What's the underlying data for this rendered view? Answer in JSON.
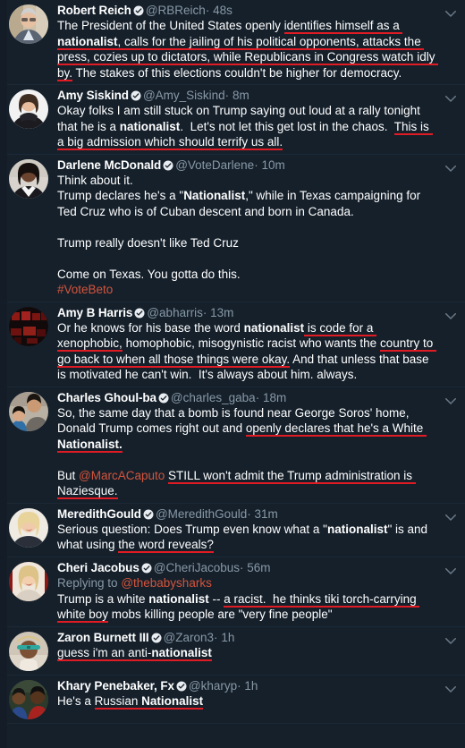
{
  "app": {
    "name": "Twitter",
    "theme": "dark",
    "background_color": "#15202b",
    "accent_color": "#1da1f2",
    "mention_color": "#d4543c",
    "annotation_underline_color": "#e01b24",
    "secondary_text_color": "#8899a6",
    "chevron_icon": "chevron-down-icon",
    "verified_icon": "verified-badge-icon",
    "time_separator": "·"
  },
  "tweets": [
    {
      "id": "tweet-robert-reich",
      "display_name": "Robert Reich",
      "verified": true,
      "handle": "@RBReich",
      "timestamp": "48s",
      "replying_to": null,
      "avatar": "photo-man-glasses-gray-jacket",
      "text_plain": "The President of the United States openly identifies himself as a nationalist, calls for the jailing of his political opponents, attacks the press, cozies up to dictators, while Republicans in Congress watch idly by. The stakes of this elections couldn't be higher for democracy.",
      "segments": [
        {
          "t": "The President of the United States openly ",
          "bold": false,
          "ul": false
        },
        {
          "t": "identifies himself as a ",
          "bold": false,
          "ul": true
        },
        {
          "t": "nationalist",
          "bold": true,
          "ul": true
        },
        {
          "t": ", calls for the jailing of his political opponents, attacks the press, cozies up to dictators, while Republicans in Congress watch idly by.",
          "bold": false,
          "ul": true
        },
        {
          "t": " The stakes of this elections couldn't be higher for democracy.",
          "bold": false,
          "ul": false
        }
      ]
    },
    {
      "id": "tweet-amy-siskind",
      "display_name": "Amy Siskind",
      "verified": true,
      "handle": "@Amy_Siskind",
      "timestamp": "8m",
      "replying_to": null,
      "avatar": "photo-woman-dark-top",
      "text_plain": "Okay folks I am still stuck on Trump saying out loud at a rally tonight that he is a nationalist.  Let's not let this get lost in the chaos.  This is a big admission which should terrify us all.",
      "segments": [
        {
          "t": "Okay folks I am still stuck on Trump saying out loud at a rally tonight that he is a ",
          "bold": false,
          "ul": false
        },
        {
          "t": "nationalist",
          "bold": true,
          "ul": false
        },
        {
          "t": ".  Let's not let this get lost in the chaos.  ",
          "bold": false,
          "ul": false
        },
        {
          "t": "This is a big admission which should terrify us all.",
          "bold": false,
          "ul": true
        }
      ]
    },
    {
      "id": "tweet-darlene-mcdonald",
      "display_name": "Darlene McDonald",
      "verified": true,
      "handle": "@VoteDarlene",
      "timestamp": "10m",
      "replying_to": null,
      "avatar": "photo-woman-dark-hair-white-collar",
      "text_plain": "Think about it.\nTrump declares he's a \"Nationalist,\" while in Texas campaigning for Ted Cruz who is of Cuban descent and born in Canada.\n\nTrump really doesn't like Ted Cruz\n\nCome on Texas. You gotta do this.\n#VoteBeto",
      "segments": [
        {
          "t": "Think about it.\n",
          "bold": false,
          "ul": false
        },
        {
          "t": "Trump declares he's a \"",
          "bold": false,
          "ul": false
        },
        {
          "t": "Nationalist",
          "bold": true,
          "ul": false
        },
        {
          "t": ",\" while in Texas campaigning for Ted Cruz who is of Cuban descent and born in Canada.\n\nTrump really doesn't like Ted Cruz\n\nCome on Texas. You gotta do this.\n",
          "bold": false,
          "ul": false
        },
        {
          "t": "#VoteBeto",
          "bold": false,
          "ul": false,
          "hashtag": true
        }
      ]
    },
    {
      "id": "tweet-amy-b-harris",
      "display_name": "Amy B Harris",
      "verified": true,
      "handle": "@abharris",
      "timestamp": "13m",
      "replying_to": null,
      "avatar": "photo-dark-red-crowd",
      "text_plain": "Or he knows for his base the word nationalist is code for a xenophobic, homophobic, misogynistic racist who wants the country to go back to when all those things were okay. And that unless that base is motivated he can't win.  It's always about him. always.",
      "segments": [
        {
          "t": "Or he knows for his base the word ",
          "bold": false,
          "ul": false
        },
        {
          "t": "nationalist",
          "bold": true,
          "ul": false
        },
        {
          "t": " is code for a xenophobic,",
          "bold": false,
          "ul": true
        },
        {
          "t": " homophobic, misogynistic racist who wants the ",
          "bold": false,
          "ul": false
        },
        {
          "t": "country to go back to when all those things were okay.",
          "bold": false,
          "ul": true
        },
        {
          "t": " And that unless that base is motivated he can't win.  It's always about him. always.",
          "bold": false,
          "ul": false
        }
      ]
    },
    {
      "id": "tweet-charles-ghoul-ba",
      "display_name": "Charles Ghoul-ba",
      "verified": true,
      "handle": "@charles_gaba",
      "timestamp": "18m",
      "replying_to": null,
      "avatar": "photo-man-with-child",
      "text_plain": "So, the same day that a bomb is found near George Soros' home, Donald Trump comes right out and openly declares that he's a White Nationalist.\n\nBut @MarcACaputo STILL won't admit the Trump administration is Naziesque.",
      "segments": [
        {
          "t": "So, the same day that a bomb is found near George Soros' home, Donald Trump comes right out and ",
          "bold": false,
          "ul": false
        },
        {
          "t": "openly declares that he's a White ",
          "bold": false,
          "ul": true
        },
        {
          "t": "Nationalist.",
          "bold": true,
          "ul": true
        },
        {
          "t": "\n\nBut ",
          "bold": false,
          "ul": false
        },
        {
          "t": "@MarcACaputo",
          "bold": false,
          "ul": false,
          "mention": true
        },
        {
          "t": " ",
          "bold": false,
          "ul": false
        },
        {
          "t": "STILL won't admit the Trump administration is Naziesque.",
          "bold": false,
          "ul": true
        }
      ]
    },
    {
      "id": "tweet-meredith-gould",
      "display_name": "MeredithGould",
      "verified": true,
      "handle": "@MeredithGould",
      "timestamp": "31m",
      "replying_to": null,
      "avatar": "photo-blonde-woman-smiling",
      "text_plain": "Serious question: Does Trump even know what a \"nationalist\" is and what using the word reveals?",
      "segments": [
        {
          "t": "Serious question: Does Trump even know what a \"",
          "bold": false,
          "ul": false
        },
        {
          "t": "nationalist",
          "bold": true,
          "ul": false
        },
        {
          "t": "\" is and what using ",
          "bold": false,
          "ul": false
        },
        {
          "t": "the word reveals?",
          "bold": false,
          "ul": true
        }
      ]
    },
    {
      "id": "tweet-cheri-jacobus",
      "display_name": "Cheri Jacobus",
      "verified": true,
      "handle": "@CheriJacobus",
      "timestamp": "56m",
      "replying_to": "@thebabysharks",
      "replying_to_label": "Replying to",
      "avatar": "photo-blonde-woman-red-background",
      "text_plain": "Trump is a white nationalist -- a racist.  he thinks tiki torch-carrying white boy mobs killing people are \"very fine people\"",
      "segments": [
        {
          "t": "Trump is a white ",
          "bold": false,
          "ul": false
        },
        {
          "t": "nationalist",
          "bold": true,
          "ul": false
        },
        {
          "t": " -- ",
          "bold": false,
          "ul": false
        },
        {
          "t": "a racist.  he thinks tiki torch-carrying white boy",
          "bold": false,
          "ul": true
        },
        {
          "t": " mobs killing people are \"very fine people\"",
          "bold": false,
          "ul": false
        }
      ]
    },
    {
      "id": "tweet-zaron-burnett",
      "display_name": "Zaron Burnett III",
      "verified": true,
      "handle": "@Zaron3",
      "timestamp": "1h",
      "replying_to": null,
      "avatar": "photo-person-sunglasses-hat",
      "text_plain": "guess i'm an anti-nationalist",
      "segments": [
        {
          "t": "guess i'm an anti-",
          "bold": false,
          "ul": true
        },
        {
          "t": "nationalist",
          "bold": true,
          "ul": true
        }
      ]
    },
    {
      "id": "tweet-khary-penebaker",
      "display_name": "Khary Penebaker, Fx",
      "verified": true,
      "handle": "@kharyp",
      "timestamp": "1h",
      "replying_to": null,
      "avatar": "photo-two-men-smiling",
      "text_plain": "He's a Russian Nationalist",
      "segments": [
        {
          "t": "He's a ",
          "bold": false,
          "ul": false
        },
        {
          "t": "Russian ",
          "bold": false,
          "ul": true
        },
        {
          "t": "Nationalist",
          "bold": true,
          "ul": true
        }
      ]
    }
  ]
}
